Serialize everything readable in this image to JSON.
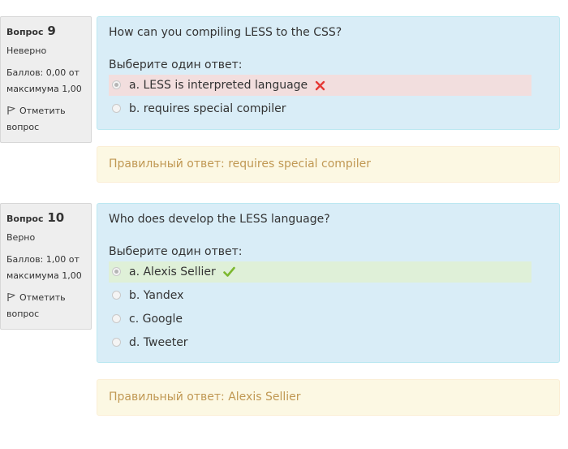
{
  "questions": [
    {
      "label": "Вопрос",
      "number": "9",
      "state": "Неверно",
      "grade_line1": "Баллов: 0,00 от",
      "grade_line2": "максимума 1,00",
      "flag_label": "Отметить",
      "flag_label2": "вопрос",
      "text": "How can you compiling LESS to the CSS?",
      "prompt": "Выберите один ответ:",
      "answers": [
        {
          "label": "a. LESS is interpreted language",
          "checked": true,
          "result": "incorrect"
        },
        {
          "label": "b. requires special compiler",
          "checked": false,
          "result": ""
        }
      ],
      "right_answer": "Правильный ответ: requires special compiler"
    },
    {
      "label": "Вопрос",
      "number": "10",
      "state": "Верно",
      "grade_line1": "Баллов: 1,00 от",
      "grade_line2": "максимума 1,00",
      "flag_label": "Отметить",
      "flag_label2": "вопрос",
      "text": "Who does develop the LESS language?",
      "prompt": "Выберите один ответ:",
      "answers": [
        {
          "label": "a. Alexis Sellier",
          "checked": true,
          "result": "correct"
        },
        {
          "label": "b. Yandex",
          "checked": false,
          "result": ""
        },
        {
          "label": "c. Google",
          "checked": false,
          "result": ""
        },
        {
          "label": "d. Tweeter",
          "checked": false,
          "result": ""
        }
      ],
      "right_answer": "Правильный ответ: Alexis Sellier"
    }
  ],
  "colors": {
    "incorrect_mark": "#e53935",
    "correct_mark": "#7cb82f",
    "formulation_bg": "#d9edf7",
    "rightanswer_text": "#c09853"
  }
}
